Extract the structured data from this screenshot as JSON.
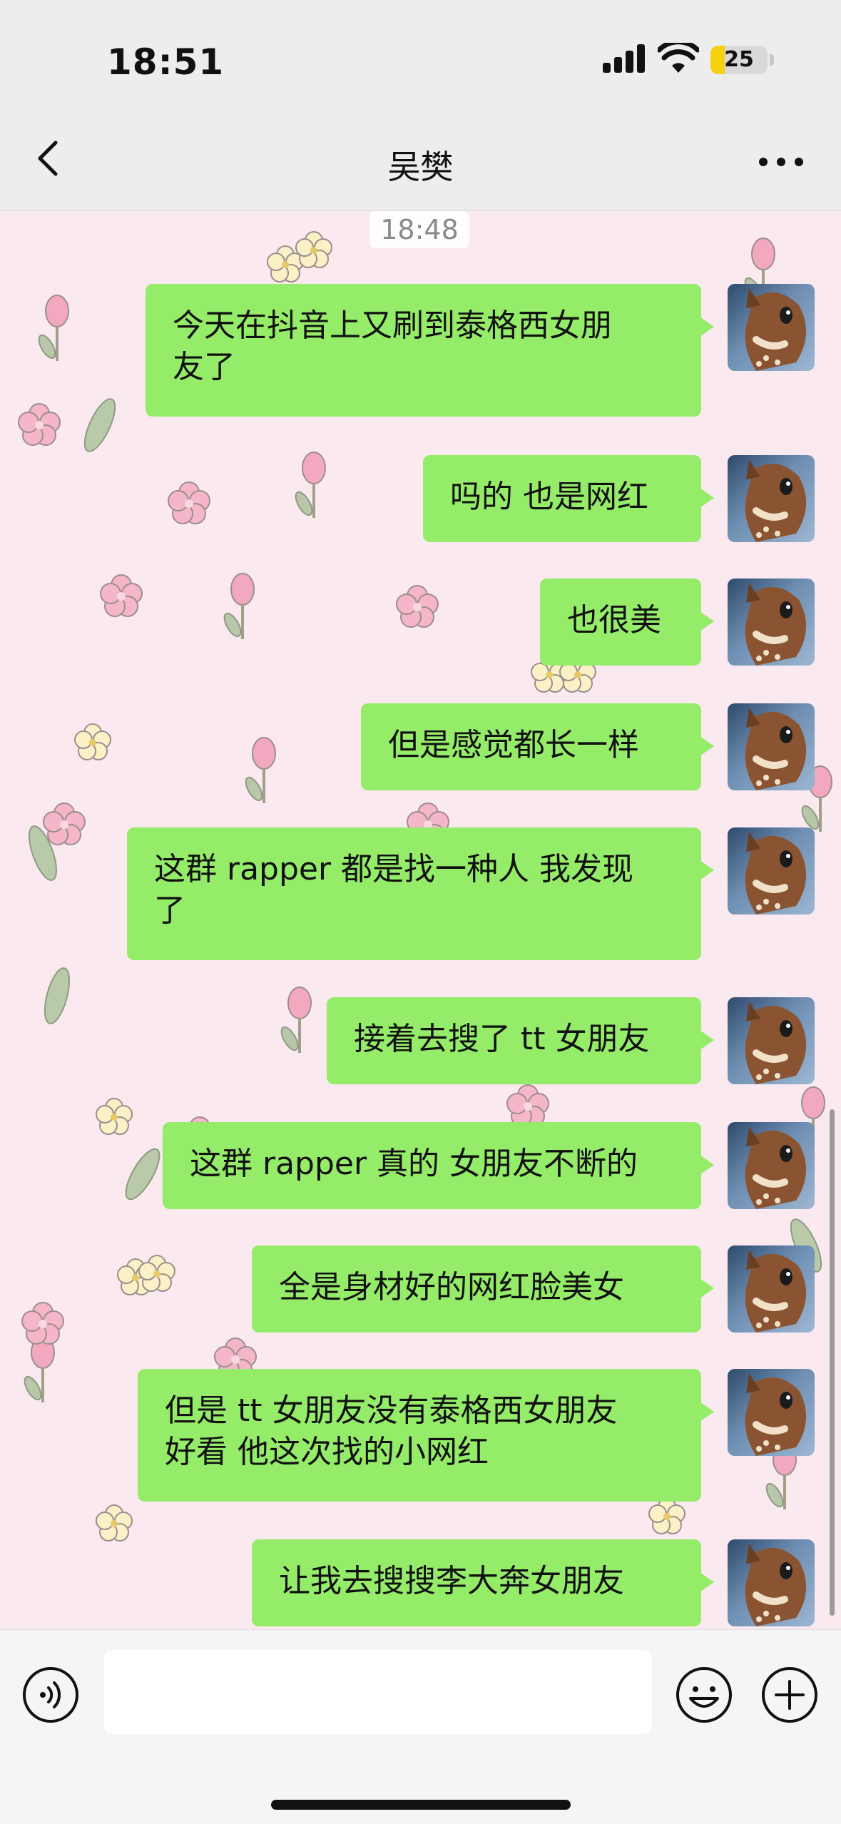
{
  "status_bar": {
    "time": "18:51",
    "battery_level": "25",
    "battery_fill_percent": 25
  },
  "nav": {
    "title": "吴樊",
    "back_icon": "chevron-left-icon",
    "more_icon": "more-dots-icon"
  },
  "chat": {
    "timestamp": "18:48",
    "messages": [
      {
        "text": "今天在抖音上又刷到泰格西女朋\n友了"
      },
      {
        "text": "吗的 也是网红"
      },
      {
        "text": "也很美"
      },
      {
        "text": "但是感觉都长一样"
      },
      {
        "text": "这群 rapper 都是找一种人 我发现\n了"
      },
      {
        "text": "接着去搜了 tt 女朋友"
      },
      {
        "text": "这群 rapper 真的 女朋友不断的"
      },
      {
        "text": "全是身材好的网红脸美女"
      },
      {
        "text": "但是 tt 女朋友没有泰格西女朋友\n好看 他这次找的小网红"
      },
      {
        "text": "让我去搜搜李大奔女朋友"
      }
    ]
  },
  "input_bar": {
    "text_value": "",
    "voice_icon": "voice-icon",
    "emoji_icon": "emoji-icon",
    "plus_icon": "plus-circle-icon"
  },
  "colors": {
    "bubble": "#95ec69",
    "chat_background": "#fae9ef",
    "bar_background": "#ededed"
  }
}
